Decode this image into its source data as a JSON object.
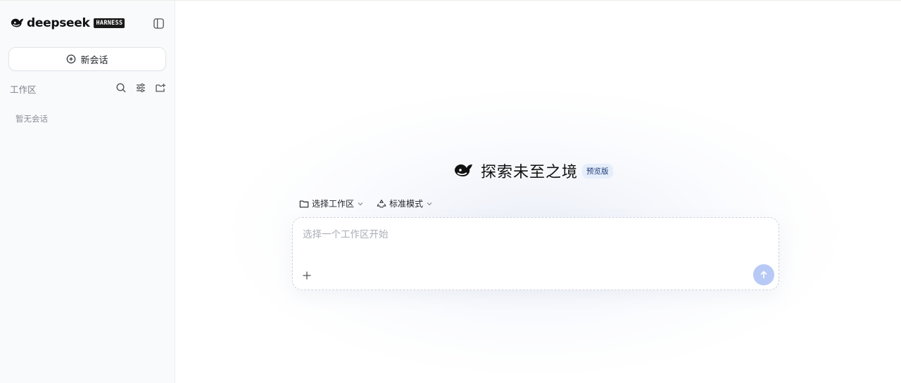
{
  "brand": {
    "name": "deepseek",
    "badge": "HARNESS"
  },
  "sidebar": {
    "new_chat_label": "新会话",
    "workspace_label": "工作区",
    "empty_label": "暂无会话",
    "icons": [
      "search-icon",
      "filter-icon",
      "add-folder-icon"
    ]
  },
  "hero": {
    "title": "探索未至之境",
    "badge": "预览版"
  },
  "selectors": {
    "workspace_label": "选择工作区",
    "mode_label": "标准模式"
  },
  "composer": {
    "placeholder": "选择一个工作区开始"
  },
  "colors": {
    "accent": "#b7c9f5",
    "badge_bg": "#e6eefb",
    "sidebar_bg": "#f9fafc"
  }
}
